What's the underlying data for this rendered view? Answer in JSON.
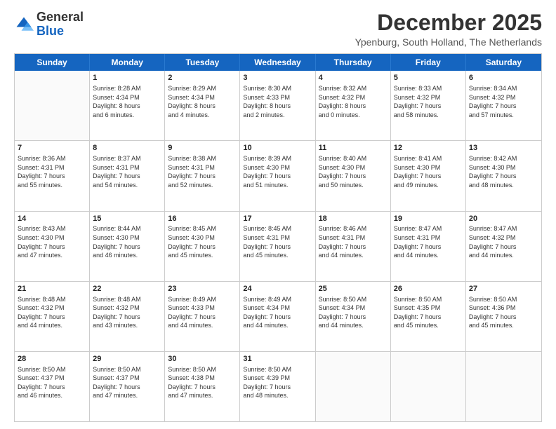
{
  "logo": {
    "general": "General",
    "blue": "Blue"
  },
  "title": "December 2025",
  "subtitle": "Ypenburg, South Holland, The Netherlands",
  "header_days": [
    "Sunday",
    "Monday",
    "Tuesday",
    "Wednesday",
    "Thursday",
    "Friday",
    "Saturday"
  ],
  "weeks": [
    [
      {
        "day": "",
        "info": ""
      },
      {
        "day": "1",
        "info": "Sunrise: 8:28 AM\nSunset: 4:34 PM\nDaylight: 8 hours\nand 6 minutes."
      },
      {
        "day": "2",
        "info": "Sunrise: 8:29 AM\nSunset: 4:34 PM\nDaylight: 8 hours\nand 4 minutes."
      },
      {
        "day": "3",
        "info": "Sunrise: 8:30 AM\nSunset: 4:33 PM\nDaylight: 8 hours\nand 2 minutes."
      },
      {
        "day": "4",
        "info": "Sunrise: 8:32 AM\nSunset: 4:32 PM\nDaylight: 8 hours\nand 0 minutes."
      },
      {
        "day": "5",
        "info": "Sunrise: 8:33 AM\nSunset: 4:32 PM\nDaylight: 7 hours\nand 58 minutes."
      },
      {
        "day": "6",
        "info": "Sunrise: 8:34 AM\nSunset: 4:32 PM\nDaylight: 7 hours\nand 57 minutes."
      }
    ],
    [
      {
        "day": "7",
        "info": "Sunrise: 8:36 AM\nSunset: 4:31 PM\nDaylight: 7 hours\nand 55 minutes."
      },
      {
        "day": "8",
        "info": "Sunrise: 8:37 AM\nSunset: 4:31 PM\nDaylight: 7 hours\nand 54 minutes."
      },
      {
        "day": "9",
        "info": "Sunrise: 8:38 AM\nSunset: 4:31 PM\nDaylight: 7 hours\nand 52 minutes."
      },
      {
        "day": "10",
        "info": "Sunrise: 8:39 AM\nSunset: 4:30 PM\nDaylight: 7 hours\nand 51 minutes."
      },
      {
        "day": "11",
        "info": "Sunrise: 8:40 AM\nSunset: 4:30 PM\nDaylight: 7 hours\nand 50 minutes."
      },
      {
        "day": "12",
        "info": "Sunrise: 8:41 AM\nSunset: 4:30 PM\nDaylight: 7 hours\nand 49 minutes."
      },
      {
        "day": "13",
        "info": "Sunrise: 8:42 AM\nSunset: 4:30 PM\nDaylight: 7 hours\nand 48 minutes."
      }
    ],
    [
      {
        "day": "14",
        "info": "Sunrise: 8:43 AM\nSunset: 4:30 PM\nDaylight: 7 hours\nand 47 minutes."
      },
      {
        "day": "15",
        "info": "Sunrise: 8:44 AM\nSunset: 4:30 PM\nDaylight: 7 hours\nand 46 minutes."
      },
      {
        "day": "16",
        "info": "Sunrise: 8:45 AM\nSunset: 4:30 PM\nDaylight: 7 hours\nand 45 minutes."
      },
      {
        "day": "17",
        "info": "Sunrise: 8:45 AM\nSunset: 4:31 PM\nDaylight: 7 hours\nand 45 minutes."
      },
      {
        "day": "18",
        "info": "Sunrise: 8:46 AM\nSunset: 4:31 PM\nDaylight: 7 hours\nand 44 minutes."
      },
      {
        "day": "19",
        "info": "Sunrise: 8:47 AM\nSunset: 4:31 PM\nDaylight: 7 hours\nand 44 minutes."
      },
      {
        "day": "20",
        "info": "Sunrise: 8:47 AM\nSunset: 4:32 PM\nDaylight: 7 hours\nand 44 minutes."
      }
    ],
    [
      {
        "day": "21",
        "info": "Sunrise: 8:48 AM\nSunset: 4:32 PM\nDaylight: 7 hours\nand 44 minutes."
      },
      {
        "day": "22",
        "info": "Sunrise: 8:48 AM\nSunset: 4:32 PM\nDaylight: 7 hours\nand 43 minutes."
      },
      {
        "day": "23",
        "info": "Sunrise: 8:49 AM\nSunset: 4:33 PM\nDaylight: 7 hours\nand 44 minutes."
      },
      {
        "day": "24",
        "info": "Sunrise: 8:49 AM\nSunset: 4:34 PM\nDaylight: 7 hours\nand 44 minutes."
      },
      {
        "day": "25",
        "info": "Sunrise: 8:50 AM\nSunset: 4:34 PM\nDaylight: 7 hours\nand 44 minutes."
      },
      {
        "day": "26",
        "info": "Sunrise: 8:50 AM\nSunset: 4:35 PM\nDaylight: 7 hours\nand 45 minutes."
      },
      {
        "day": "27",
        "info": "Sunrise: 8:50 AM\nSunset: 4:36 PM\nDaylight: 7 hours\nand 45 minutes."
      }
    ],
    [
      {
        "day": "28",
        "info": "Sunrise: 8:50 AM\nSunset: 4:37 PM\nDaylight: 7 hours\nand 46 minutes."
      },
      {
        "day": "29",
        "info": "Sunrise: 8:50 AM\nSunset: 4:37 PM\nDaylight: 7 hours\nand 47 minutes."
      },
      {
        "day": "30",
        "info": "Sunrise: 8:50 AM\nSunset: 4:38 PM\nDaylight: 7 hours\nand 47 minutes."
      },
      {
        "day": "31",
        "info": "Sunrise: 8:50 AM\nSunset: 4:39 PM\nDaylight: 7 hours\nand 48 minutes."
      },
      {
        "day": "",
        "info": ""
      },
      {
        "day": "",
        "info": ""
      },
      {
        "day": "",
        "info": ""
      }
    ]
  ]
}
